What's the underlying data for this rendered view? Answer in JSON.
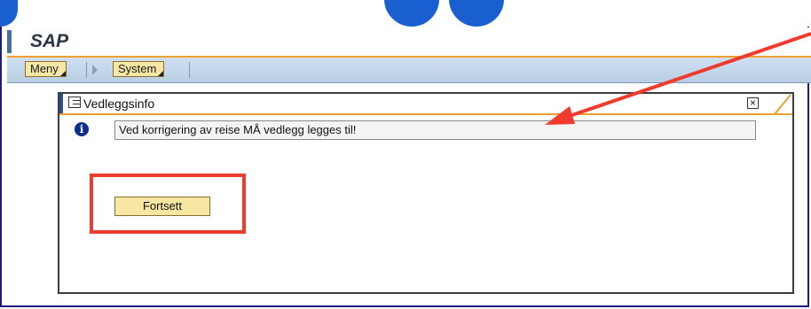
{
  "app": {
    "title": "SAP"
  },
  "menubar": {
    "items": [
      "Meny",
      "System"
    ]
  },
  "dialog": {
    "title": "Vedleggsinfo",
    "message": "Ved korrigering av reise MÅ vedlegg legges til!",
    "button_label": "Fortsett"
  },
  "annotation": {
    "arrow_color": "#ef3b2d",
    "highlight_color": "#ef3b2d"
  },
  "colors": {
    "slide_heading": "#1a5fd0",
    "sap_accent": "#f0a030",
    "menubar_bg": "#c5d8ec"
  }
}
